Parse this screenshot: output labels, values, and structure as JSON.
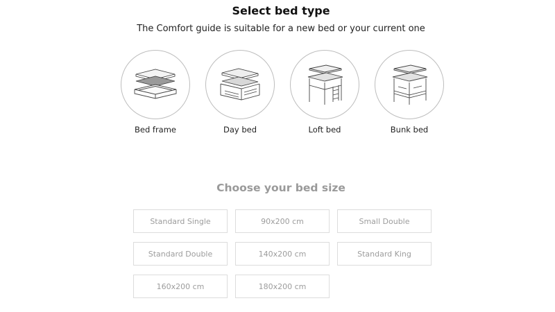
{
  "header": {
    "title": "Select bed type",
    "subtitle": "The Comfort guide is suitable for a new bed or your current one"
  },
  "bed_types": [
    {
      "label": "Bed frame",
      "icon": "bed-frame-icon"
    },
    {
      "label": "Day bed",
      "icon": "day-bed-icon"
    },
    {
      "label": "Loft bed",
      "icon": "loft-bed-icon"
    },
    {
      "label": "Bunk bed",
      "icon": "bunk-bed-icon"
    }
  ],
  "size_section": {
    "title": "Choose your bed size",
    "options": [
      "Standard Single",
      "90x200 cm",
      "Small Double",
      "Standard Double",
      "140x200 cm",
      "Standard King",
      "160x200 cm",
      "180x200 cm"
    ]
  },
  "colors": {
    "text": "#222222",
    "muted": "#9c9c9c",
    "border": "#dcdcdc",
    "circle_border": "#bdbdbd"
  }
}
